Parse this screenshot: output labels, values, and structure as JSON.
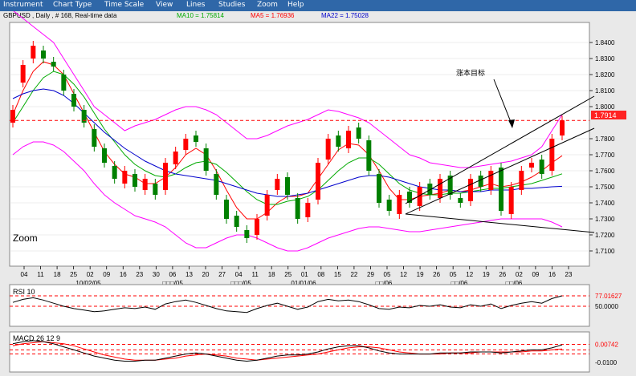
{
  "menu": [
    "Instrument",
    "Chart Type",
    "Time Scale",
    "View",
    "Lines",
    "Studies",
    "Zoom",
    "Help"
  ],
  "header": {
    "instrument": "GBPUSD , Daily , # 168, Real-time data",
    "ma10": "MA10 = 1.75814",
    "ma5": "MA5 = 1.76936",
    "ma22": "MA22 = 1.75028"
  },
  "annotation": "涨本目标",
  "zoom_label": "Zoom",
  "colors": {
    "up_candle": "#ff0000",
    "down_candle": "#008000",
    "ma5": "#ff0000",
    "ma10": "#00aa00",
    "ma22": "#0000cc",
    "bollinger": "#ff00ff",
    "panel_bg": "#ffffff",
    "menu_bg": "#2f67a8",
    "rsi_line": "#000000",
    "macd_line": "#000000",
    "macd_signal": "#ff0000"
  },
  "chart_data": [
    {
      "type": "candlestick",
      "title": "GBPUSD , Daily , # 168, Real-time data",
      "ylim": [
        1.7025,
        1.8505
      ],
      "y_ticks": [
        "1.8400",
        "1.8300",
        "1.8200",
        "1.8100",
        "1.8000",
        "1.7800",
        "1.7700",
        "1.7600",
        "1.7500",
        "1.7400",
        "1.7300",
        "1.7200",
        "1.7100"
      ],
      "reference_line": {
        "value": 1.7914,
        "label": "1.7914"
      },
      "last_price": 1.7914,
      "x_ticks": [
        "04",
        "11",
        "18",
        "25",
        "02",
        "09",
        "16",
        "23",
        "30",
        "06",
        "13",
        "20",
        "27",
        "04",
        "11",
        "18",
        "25",
        "01",
        "08",
        "15",
        "22",
        "29",
        "05",
        "12",
        "19",
        "26",
        "05",
        "12",
        "19",
        "26",
        "02",
        "09",
        "16",
        "23"
      ],
      "date_labels": [
        "10/02/05",
        "□□□/05",
        "□□□/05",
        "01/01/06",
        "□□/06",
        "□□/06",
        "□□/06"
      ],
      "close": [
        1.798,
        1.826,
        1.838,
        1.83,
        1.825,
        1.81,
        1.8,
        1.79,
        1.775,
        1.765,
        1.755,
        1.76,
        1.75,
        1.755,
        1.745,
        1.765,
        1.772,
        1.78,
        1.778,
        1.76,
        1.745,
        1.73,
        1.725,
        1.718,
        1.73,
        1.745,
        1.755,
        1.745,
        1.73,
        1.74,
        1.765,
        1.78,
        1.775,
        1.785,
        1.78,
        1.76,
        1.74,
        1.735,
        1.745,
        1.74,
        1.75,
        1.745,
        1.755,
        1.745,
        1.74,
        1.755,
        1.75,
        1.76,
        1.735,
        1.75,
        1.76,
        1.765,
        1.758,
        1.78,
        1.7914
      ],
      "open": [
        1.79,
        1.815,
        1.83,
        1.835,
        1.828,
        1.82,
        1.808,
        1.798,
        1.786,
        1.774,
        1.763,
        1.752,
        1.758,
        1.748,
        1.752,
        1.748,
        1.764,
        1.773,
        1.782,
        1.774,
        1.758,
        1.742,
        1.732,
        1.723,
        1.72,
        1.732,
        1.748,
        1.756,
        1.743,
        1.731,
        1.742,
        1.767,
        1.782,
        1.774,
        1.787,
        1.779,
        1.758,
        1.742,
        1.733,
        1.747,
        1.738,
        1.752,
        1.743,
        1.757,
        1.743,
        1.741,
        1.757,
        1.748,
        1.762,
        1.733,
        1.748,
        1.762,
        1.767,
        1.76,
        1.782
      ],
      "ma_series": [
        {
          "name": "MA5",
          "values": [
            1.795,
            1.81,
            1.822,
            1.828,
            1.826,
            1.82,
            1.808,
            1.796,
            1.784,
            1.772,
            1.764,
            1.758,
            1.756,
            1.752,
            1.752,
            1.756,
            1.762,
            1.77,
            1.774,
            1.77,
            1.76,
            1.748,
            1.737,
            1.73,
            1.73,
            1.734,
            1.74,
            1.744,
            1.744,
            1.746,
            1.755,
            1.764,
            1.773,
            1.777,
            1.776,
            1.77,
            1.76,
            1.749,
            1.742,
            1.742,
            1.744,
            1.745,
            1.746,
            1.748,
            1.747,
            1.748,
            1.75,
            1.752,
            1.75,
            1.751,
            1.753,
            1.756,
            1.76,
            1.765,
            1.7694
          ]
        },
        {
          "name": "MA10",
          "values": [
            1.79,
            1.8,
            1.81,
            1.818,
            1.822,
            1.82,
            1.814,
            1.806,
            1.796,
            1.786,
            1.778,
            1.77,
            1.764,
            1.76,
            1.757,
            1.756,
            1.758,
            1.762,
            1.765,
            1.766,
            1.764,
            1.759,
            1.753,
            1.747,
            1.742,
            1.739,
            1.739,
            1.741,
            1.742,
            1.744,
            1.748,
            1.754,
            1.76,
            1.765,
            1.768,
            1.768,
            1.764,
            1.758,
            1.752,
            1.748,
            1.746,
            1.745,
            1.745,
            1.746,
            1.746,
            1.747,
            1.748,
            1.749,
            1.749,
            1.75,
            1.751,
            1.752,
            1.754,
            1.756,
            1.7581
          ]
        },
        {
          "name": "MA22",
          "values": [
            1.805,
            1.808,
            1.81,
            1.811,
            1.81,
            1.807,
            1.802,
            1.796,
            1.79,
            1.784,
            1.779,
            1.774,
            1.77,
            1.766,
            1.763,
            1.76,
            1.758,
            1.757,
            1.756,
            1.755,
            1.754,
            1.752,
            1.75,
            1.748,
            1.746,
            1.745,
            1.744,
            1.744,
            1.745,
            1.746,
            1.748,
            1.75,
            1.752,
            1.754,
            1.756,
            1.757,
            1.757,
            1.756,
            1.754,
            1.752,
            1.75,
            1.749,
            1.748,
            1.748,
            1.747,
            1.747,
            1.747,
            1.748,
            1.748,
            1.748,
            1.749,
            1.749,
            1.7495,
            1.75,
            1.7503
          ]
        }
      ],
      "bollinger_upper": [
        1.86,
        1.855,
        1.85,
        1.845,
        1.84,
        1.83,
        1.82,
        1.81,
        1.8,
        1.795,
        1.79,
        1.785,
        1.788,
        1.79,
        1.792,
        1.795,
        1.798,
        1.8,
        1.8,
        1.798,
        1.795,
        1.79,
        1.785,
        1.78,
        1.78,
        1.782,
        1.785,
        1.788,
        1.79,
        1.792,
        1.795,
        1.798,
        1.797,
        1.795,
        1.793,
        1.79,
        1.785,
        1.78,
        1.775,
        1.77,
        1.768,
        1.765,
        1.764,
        1.763,
        1.762,
        1.762,
        1.763,
        1.764,
        1.765,
        1.766,
        1.768,
        1.77,
        1.775,
        1.785,
        1.795
      ],
      "bollinger_lower": [
        1.77,
        1.775,
        1.778,
        1.778,
        1.776,
        1.772,
        1.766,
        1.76,
        1.752,
        1.745,
        1.74,
        1.736,
        1.732,
        1.73,
        1.728,
        1.725,
        1.72,
        1.715,
        1.712,
        1.712,
        1.715,
        1.718,
        1.72,
        1.72,
        1.718,
        1.715,
        1.712,
        1.71,
        1.71,
        1.712,
        1.715,
        1.718,
        1.72,
        1.722,
        1.724,
        1.725,
        1.725,
        1.724,
        1.723,
        1.722,
        1.722,
        1.723,
        1.724,
        1.725,
        1.726,
        1.727,
        1.728,
        1.729,
        1.73,
        1.73,
        1.73,
        1.73,
        1.73,
        1.728,
        1.725
      ]
    },
    {
      "type": "line",
      "title": "RSI 10",
      "ylim": [
        0,
        100
      ],
      "y_ticks": [
        "77.01627",
        "50.0000"
      ],
      "reference_lines": [
        77.01627,
        50
      ],
      "series": [
        {
          "name": "RSI 10",
          "values": [
            60,
            68,
            72,
            66,
            58,
            50,
            44,
            40,
            36,
            38,
            42,
            46,
            44,
            48,
            42,
            56,
            62,
            66,
            60,
            52,
            44,
            38,
            36,
            34,
            44,
            52,
            58,
            50,
            42,
            48,
            62,
            68,
            64,
            66,
            62,
            54,
            44,
            42,
            48,
            46,
            52,
            50,
            54,
            48,
            46,
            54,
            50,
            56,
            44,
            52,
            58,
            62,
            58,
            70,
            77
          ]
        }
      ]
    },
    {
      "type": "line",
      "title": "MACD 26 12 9",
      "ylim": [
        -0.018,
        0.018
      ],
      "y_ticks": [
        "0.00742",
        "-0.0100"
      ],
      "reference_lines": [
        0.00742,
        0.002,
        -0.002
      ],
      "series": [
        {
          "name": "MACD",
          "values": [
            0.008,
            0.01,
            0.011,
            0.01,
            0.008,
            0.005,
            0.002,
            -0.001,
            -0.004,
            -0.006,
            -0.008,
            -0.009,
            -0.009,
            -0.008,
            -0.008,
            -0.006,
            -0.004,
            -0.002,
            -0.001,
            -0.002,
            -0.004,
            -0.006,
            -0.008,
            -0.009,
            -0.008,
            -0.006,
            -0.004,
            -0.003,
            -0.003,
            -0.002,
            0.0,
            0.003,
            0.005,
            0.006,
            0.006,
            0.004,
            0.001,
            -0.001,
            -0.002,
            -0.002,
            -0.002,
            -0.002,
            -0.001,
            -0.001,
            -0.001,
            0.0,
            0.0,
            0.0,
            -0.001,
            0.0,
            0.001,
            0.002,
            0.002,
            0.004,
            0.007
          ]
        },
        {
          "name": "Signal",
          "values": [
            0.006,
            0.008,
            0.009,
            0.01,
            0.009,
            0.008,
            0.006,
            0.003,
            0.0,
            -0.003,
            -0.005,
            -0.007,
            -0.008,
            -0.008,
            -0.008,
            -0.007,
            -0.006,
            -0.004,
            -0.003,
            -0.002,
            -0.003,
            -0.004,
            -0.006,
            -0.007,
            -0.008,
            -0.007,
            -0.006,
            -0.005,
            -0.004,
            -0.003,
            -0.002,
            0.0,
            0.002,
            0.004,
            0.005,
            0.005,
            0.004,
            0.002,
            0.0,
            -0.001,
            -0.002,
            -0.002,
            -0.002,
            -0.001,
            -0.001,
            -0.001,
            0.0,
            0.0,
            0.0,
            0.0,
            0.0,
            0.001,
            0.001,
            0.002,
            0.003
          ]
        }
      ]
    }
  ]
}
